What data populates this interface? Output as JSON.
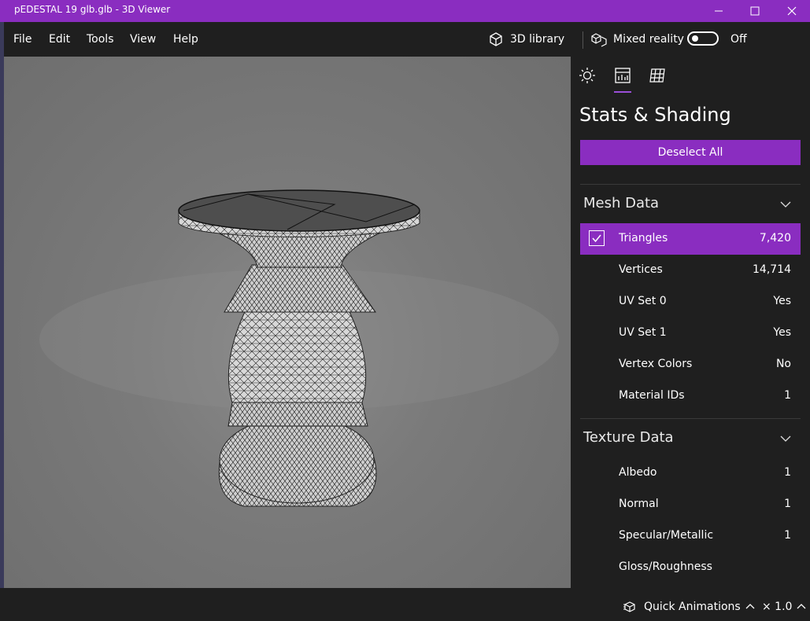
{
  "window": {
    "title": "pEDESTAL 19 glb.glb - 3D Viewer"
  },
  "menu": [
    "File",
    "Edit",
    "Tools",
    "View",
    "Help"
  ],
  "toolbar": {
    "library_label": "3D library",
    "mixed_reality_label": "Mixed reality",
    "toggle_state": "Off"
  },
  "panel": {
    "title": "Stats & Shading",
    "deselect_label": "Deselect All",
    "tabs": [
      "lighting-icon",
      "stats-icon",
      "grid-icon"
    ],
    "mesh_section": "Mesh Data",
    "mesh_rows": [
      {
        "label": "Triangles",
        "value": "7,420",
        "selected": true
      },
      {
        "label": "Vertices",
        "value": "14,714"
      },
      {
        "label": "UV Set 0",
        "value": "Yes"
      },
      {
        "label": "UV Set 1",
        "value": "Yes"
      },
      {
        "label": "Vertex Colors",
        "value": "No"
      },
      {
        "label": "Material IDs",
        "value": "1"
      }
    ],
    "texture_section": "Texture Data",
    "texture_rows": [
      {
        "label": "Albedo",
        "value": "1"
      },
      {
        "label": "Normal",
        "value": "1"
      },
      {
        "label": "Specular/Metallic",
        "value": "1"
      },
      {
        "label": "Gloss/Roughness",
        "value": ""
      }
    ]
  },
  "status": {
    "animations_label": "Quick Animations",
    "speed_label": "× 1.0"
  },
  "colors": {
    "accent": "#8a2dc0",
    "background": "#1f1f1f",
    "viewport": "#7a7a7a"
  }
}
